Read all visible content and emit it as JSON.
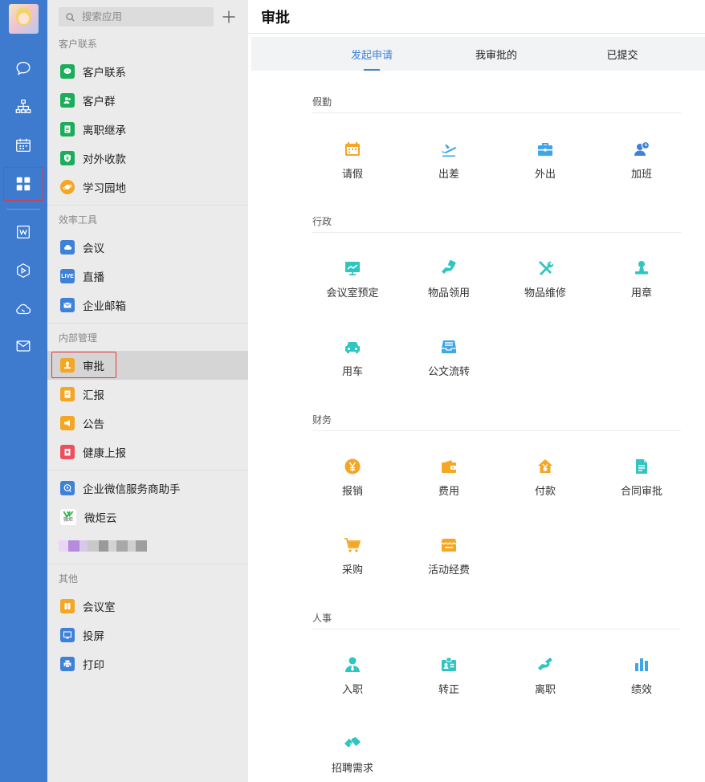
{
  "rail": {
    "colors": {
      "background": "#3e7bcf",
      "selected_outline": "#e0393e"
    },
    "items": [
      {
        "icon": "chat-bubble-icon"
      },
      {
        "icon": "org-chart-icon"
      },
      {
        "icon": "calendar-icon"
      },
      {
        "icon": "apps-grid-icon",
        "selected": true
      },
      {
        "icon": "docs-icon"
      },
      {
        "icon": "cube-icon"
      },
      {
        "icon": "cloud-icon"
      },
      {
        "icon": "mail-icon"
      }
    ]
  },
  "sidebar": {
    "search_placeholder": "搜索应用",
    "add_label": "+",
    "sections": [
      {
        "title": "客户联系",
        "items": [
          {
            "label": "客户联系",
            "icon": "wechat-icon",
            "color": "#1aad5a"
          },
          {
            "label": "客户群",
            "icon": "group-icon",
            "color": "#1aad5a"
          },
          {
            "label": "离职继承",
            "icon": "doc-icon",
            "color": "#1aad5a"
          },
          {
            "label": "对外收款",
            "icon": "shield-yuan-icon",
            "color": "#1aad5a"
          },
          {
            "label": "学习园地",
            "icon": "planet-icon",
            "color": "#f5a623"
          }
        ]
      },
      {
        "title": "效率工具",
        "items": [
          {
            "label": "会议",
            "icon": "cloud-meeting-icon",
            "color": "#3e82d8"
          },
          {
            "label": "直播",
            "icon": "live-icon",
            "color": "#3e82d8",
            "badge": "LIVE"
          },
          {
            "label": "企业邮箱",
            "icon": "envelope-icon",
            "color": "#3e82d8"
          }
        ]
      },
      {
        "title": "内部管理",
        "items": [
          {
            "label": "审批",
            "icon": "stamp-icon",
            "color": "#f5a623",
            "selected": true
          },
          {
            "label": "汇报",
            "icon": "report-icon",
            "color": "#f5a623"
          },
          {
            "label": "公告",
            "icon": "megaphone-icon",
            "color": "#f5a623"
          },
          {
            "label": "健康上报",
            "icon": "health-icon",
            "color": "#ee4f5d"
          }
        ]
      },
      {
        "title": "",
        "items": [
          {
            "label": "企业微信服务商助手",
            "icon": "assistant-icon",
            "color": "#3e82d8"
          },
          {
            "label": "微炬云",
            "icon": "weiju-logo-icon",
            "color": "#ffffff"
          }
        ]
      },
      {
        "title": "其他",
        "items": [
          {
            "label": "会议室",
            "icon": "room-icon",
            "color": "#f5a623"
          },
          {
            "label": "投屏",
            "icon": "cast-icon",
            "color": "#3e82d8"
          },
          {
            "label": "打印",
            "icon": "printer-icon",
            "color": "#3e82d8"
          }
        ]
      }
    ],
    "weiju_logo_text": "微炬"
  },
  "main": {
    "title": "审批",
    "tabs": [
      {
        "label": "发起申请",
        "active": true
      },
      {
        "label": "我审批的"
      },
      {
        "label": "已提交"
      }
    ],
    "accent": "#3e82d8",
    "groups": [
      {
        "title": "假勤",
        "apps": [
          {
            "label": "请假",
            "icon": "calendar-leave-icon",
            "color": "#f5a623"
          },
          {
            "label": "出差",
            "icon": "airplane-icon",
            "color": "#3ea6e6"
          },
          {
            "label": "外出",
            "icon": "briefcase-icon",
            "color": "#3ea6e6"
          },
          {
            "label": "加班",
            "icon": "overtime-icon",
            "color": "#3e82d8"
          }
        ]
      },
      {
        "title": "行政",
        "apps": [
          {
            "label": "会议室预定",
            "icon": "board-chart-icon",
            "color": "#2fc5c1"
          },
          {
            "label": "物品领用",
            "icon": "hand-receive-icon",
            "color": "#2fc5c1"
          },
          {
            "label": "物品维修",
            "icon": "tools-icon",
            "color": "#2fc5c1"
          },
          {
            "label": "用章",
            "icon": "seal-icon",
            "color": "#2fc5c1"
          },
          {
            "label": "用车",
            "icon": "car-icon",
            "color": "#2fc5c1"
          },
          {
            "label": "公文流转",
            "icon": "inbox-icon",
            "color": "#3ea6e6"
          }
        ]
      },
      {
        "title": "财务",
        "apps": [
          {
            "label": "报销",
            "icon": "coin-yuan-icon",
            "color": "#f5a623"
          },
          {
            "label": "费用",
            "icon": "wallet-icon",
            "color": "#f5a623"
          },
          {
            "label": "付款",
            "icon": "house-yuan-icon",
            "color": "#f5a623"
          },
          {
            "label": "合同审批",
            "icon": "contract-icon",
            "color": "#2fc5c1"
          },
          {
            "label": "采购",
            "icon": "cart-icon",
            "color": "#f5a623"
          },
          {
            "label": "活动经费",
            "icon": "shop-icon",
            "color": "#f5a623"
          }
        ]
      },
      {
        "title": "人事",
        "apps": [
          {
            "label": "入职",
            "icon": "person-tie-icon",
            "color": "#2fc5c1"
          },
          {
            "label": "转正",
            "icon": "badge-card-icon",
            "color": "#2fc5c1"
          },
          {
            "label": "离职",
            "icon": "hand-wave-icon",
            "color": "#2fc5c1"
          },
          {
            "label": "绩效",
            "icon": "bar-chart-icon",
            "color": "#3ea6e6"
          },
          {
            "label": "招聘需求",
            "icon": "handshake-icon",
            "color": "#2fc5c1"
          }
        ]
      }
    ]
  }
}
